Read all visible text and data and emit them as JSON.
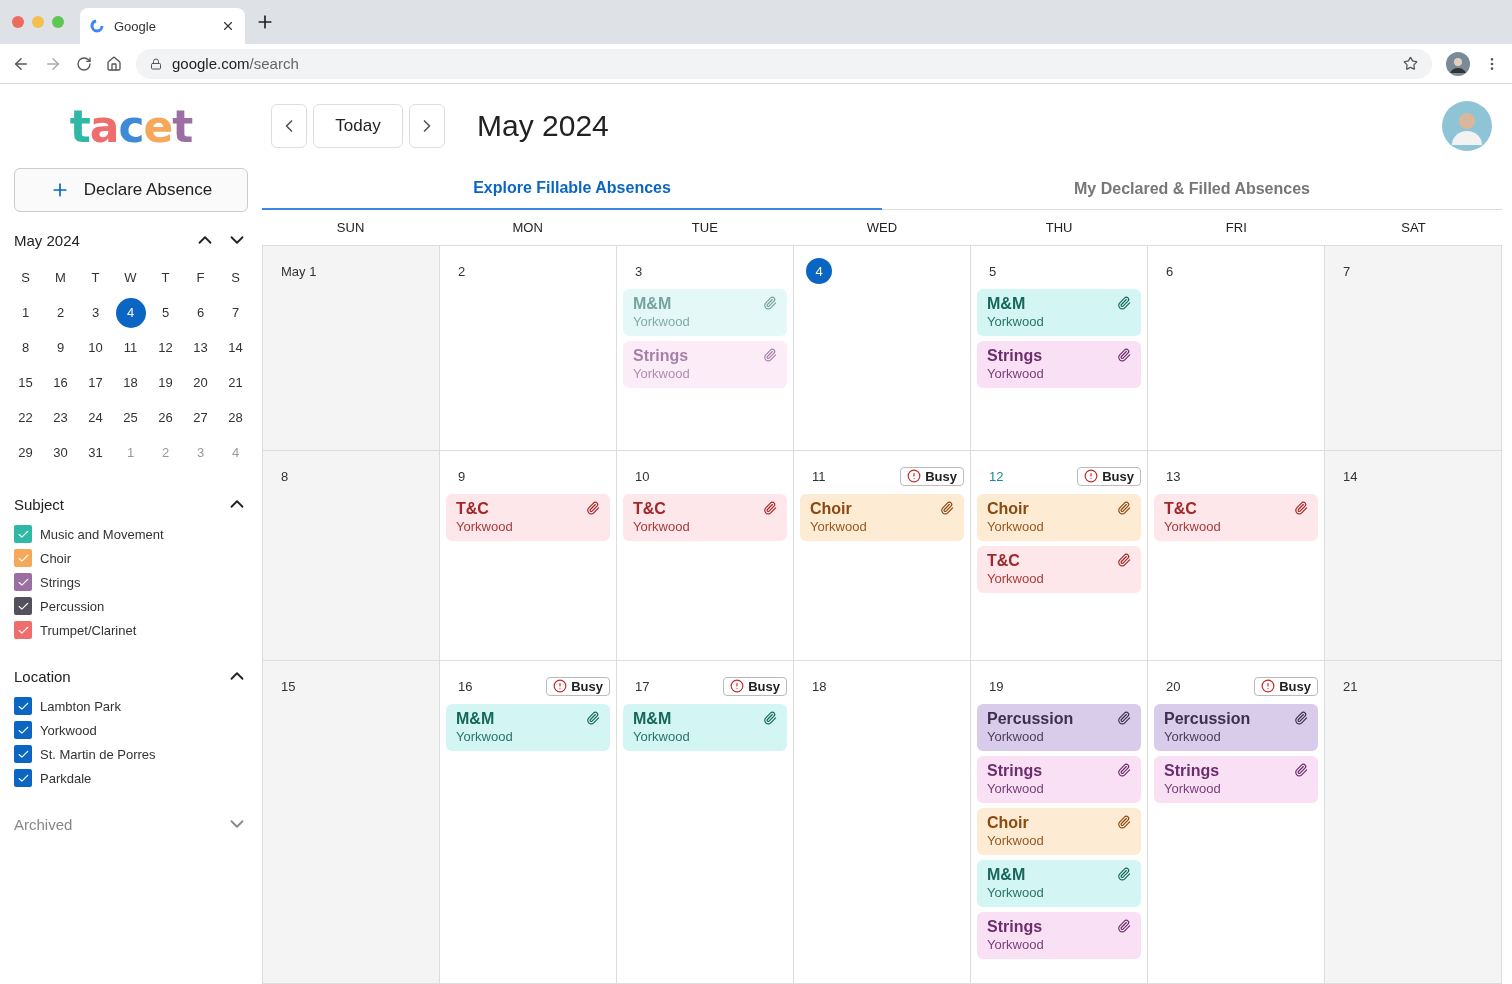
{
  "browser": {
    "tab_title": "Google",
    "url_host": "google.com",
    "url_path": "/search"
  },
  "sidebar": {
    "logo": "tacet",
    "declare_button": "Declare Absence",
    "mini_calendar": {
      "title": "May 2024",
      "weekdays": [
        "S",
        "M",
        "T",
        "W",
        "T",
        "F",
        "S"
      ],
      "weeks": [
        [
          {
            "label": "1",
            "selected": false,
            "outside": false
          },
          {
            "label": "2",
            "selected": false,
            "outside": false
          },
          {
            "label": "3",
            "selected": false,
            "outside": false
          },
          {
            "label": "4",
            "selected": true,
            "outside": false
          },
          {
            "label": "5",
            "selected": false,
            "outside": false
          },
          {
            "label": "6",
            "selected": false,
            "outside": false
          },
          {
            "label": "7",
            "selected": false,
            "outside": false
          }
        ],
        [
          {
            "label": "8",
            "selected": false,
            "outside": false
          },
          {
            "label": "9",
            "selected": false,
            "outside": false
          },
          {
            "label": "10",
            "selected": false,
            "outside": false
          },
          {
            "label": "11",
            "selected": false,
            "outside": false
          },
          {
            "label": "12",
            "selected": false,
            "outside": false
          },
          {
            "label": "13",
            "selected": false,
            "outside": false
          },
          {
            "label": "14",
            "selected": false,
            "outside": false
          }
        ],
        [
          {
            "label": "15",
            "selected": false,
            "outside": false
          },
          {
            "label": "16",
            "selected": false,
            "outside": false
          },
          {
            "label": "17",
            "selected": false,
            "outside": false
          },
          {
            "label": "18",
            "selected": false,
            "outside": false
          },
          {
            "label": "19",
            "selected": false,
            "outside": false
          },
          {
            "label": "20",
            "selected": false,
            "outside": false
          },
          {
            "label": "21",
            "selected": false,
            "outside": false
          }
        ],
        [
          {
            "label": "22",
            "selected": false,
            "outside": false
          },
          {
            "label": "23",
            "selected": false,
            "outside": false
          },
          {
            "label": "24",
            "selected": false,
            "outside": false
          },
          {
            "label": "25",
            "selected": false,
            "outside": false
          },
          {
            "label": "26",
            "selected": false,
            "outside": false
          },
          {
            "label": "27",
            "selected": false,
            "outside": false
          },
          {
            "label": "28",
            "selected": false,
            "outside": false
          }
        ],
        [
          {
            "label": "29",
            "selected": false,
            "outside": false
          },
          {
            "label": "30",
            "selected": false,
            "outside": false
          },
          {
            "label": "31",
            "selected": false,
            "outside": false
          },
          {
            "label": "1",
            "selected": false,
            "outside": true
          },
          {
            "label": "2",
            "selected": false,
            "outside": true
          },
          {
            "label": "3",
            "selected": false,
            "outside": true
          },
          {
            "label": "4",
            "selected": false,
            "outside": true
          }
        ]
      ]
    },
    "filters": [
      {
        "title": "Subject",
        "expanded": true,
        "items": [
          {
            "label": "Music and Movement",
            "checked": true,
            "color": "#2fb8a6"
          },
          {
            "label": "Choir",
            "checked": true,
            "color": "#f6a85a"
          },
          {
            "label": "Strings",
            "checked": true,
            "color": "#9b6fa3"
          },
          {
            "label": "Percussion",
            "checked": true,
            "color": "#55505e"
          },
          {
            "label": "Trumpet/Clarinet",
            "checked": true,
            "color": "#f06d6d"
          }
        ]
      },
      {
        "title": "Location",
        "expanded": true,
        "items": [
          {
            "label": "Lambton Park",
            "checked": true,
            "color": "#0b66c3"
          },
          {
            "label": "Yorkwood",
            "checked": true,
            "color": "#0b66c3"
          },
          {
            "label": "St. Martin de Porres",
            "checked": true,
            "color": "#0b66c3"
          },
          {
            "label": "Parkdale",
            "checked": true,
            "color": "#0b66c3"
          }
        ]
      },
      {
        "title": "Archived",
        "expanded": false
      }
    ]
  },
  "toolbar": {
    "today_button": "Today",
    "title": "May 2024"
  },
  "tabs": [
    {
      "label": "Explore Fillable Absences",
      "selected": true
    },
    {
      "label": "My Declared & Filled Absences",
      "selected": false
    }
  ],
  "calendar": {
    "weekdays": [
      "SUN",
      "MON",
      "TUE",
      "WED",
      "THU",
      "FRI",
      "SAT"
    ],
    "weeks": [
      [
        {
          "label": "May 1",
          "weekend": true
        },
        {
          "label": "2"
        },
        {
          "label": "3",
          "events": [
            {
              "kind": "mm",
              "title": "M&M",
              "location": "Yorkwood",
              "dimmed": true
            },
            {
              "kind": "strings",
              "title": "Strings",
              "location": "Yorkwood",
              "dimmed": true
            }
          ]
        },
        {
          "label": "4",
          "today": true
        },
        {
          "label": "5",
          "events": [
            {
              "kind": "mm",
              "title": "M&M",
              "location": "Yorkwood",
              "dimmed": false
            },
            {
              "kind": "strings",
              "title": "Strings",
              "location": "Yorkwood",
              "dimmed": false
            }
          ]
        },
        {
          "label": "6"
        },
        {
          "label": "7",
          "weekend": true
        }
      ],
      [
        {
          "label": "8",
          "weekend": true
        },
        {
          "label": "9",
          "events": [
            {
              "kind": "tc",
              "title": "T&C",
              "location": "Yorkwood",
              "dimmed": false
            }
          ]
        },
        {
          "label": "10",
          "events": [
            {
              "kind": "tc",
              "title": "T&C",
              "location": "Yorkwood",
              "dimmed": false
            }
          ]
        },
        {
          "label": "11",
          "busy": "Busy",
          "events": [
            {
              "kind": "choir",
              "title": "Choir",
              "location": "Yorkwood",
              "dimmed": false
            }
          ]
        },
        {
          "label": "12",
          "accent": true,
          "busy": "Busy",
          "events": [
            {
              "kind": "choir",
              "title": "Choir",
              "location": "Yorkwood",
              "dimmed": false
            },
            {
              "kind": "tc",
              "title": "T&C",
              "location": "Yorkwood",
              "dimmed": false
            }
          ]
        },
        {
          "label": "13",
          "events": [
            {
              "kind": "tc",
              "title": "T&C",
              "location": "Yorkwood",
              "dimmed": false
            }
          ]
        },
        {
          "label": "14",
          "weekend": true
        }
      ],
      [
        {
          "label": "15",
          "weekend": true
        },
        {
          "label": "16",
          "busy": "Busy",
          "events": [
            {
              "kind": "mm",
              "title": "M&M",
              "location": "Yorkwood",
              "dimmed": false
            }
          ]
        },
        {
          "label": "17",
          "busy": "Busy",
          "events": [
            {
              "kind": "mm",
              "title": "M&M",
              "location": "Yorkwood",
              "dimmed": false
            }
          ]
        },
        {
          "label": "18"
        },
        {
          "label": "19",
          "events": [
            {
              "kind": "percussion",
              "title": "Percussion",
              "location": "Yorkwood",
              "dimmed": false
            },
            {
              "kind": "strings",
              "title": "Strings",
              "location": "Yorkwood",
              "dimmed": false
            },
            {
              "kind": "choir",
              "title": "Choir",
              "location": "Yorkwood",
              "dimmed": false
            },
            {
              "kind": "mm",
              "title": "M&M",
              "location": "Yorkwood",
              "dimmed": false
            },
            {
              "kind": "strings",
              "title": "Strings",
              "location": "Yorkwood",
              "dimmed": false
            }
          ]
        },
        {
          "label": "20",
          "busy": "Busy",
          "events": [
            {
              "kind": "percussion",
              "title": "Percussion",
              "location": "Yorkwood",
              "dimmed": false
            },
            {
              "kind": "strings",
              "title": "Strings",
              "location": "Yorkwood",
              "dimmed": false
            }
          ]
        },
        {
          "label": "21",
          "weekend": true
        }
      ]
    ]
  }
}
